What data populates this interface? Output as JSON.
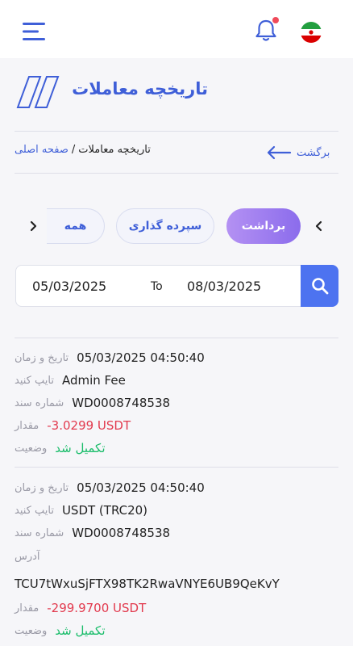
{
  "header": {
    "menu_icon": "hamburger-menu-icon",
    "bell_icon": "bell-icon",
    "notification_dot_color": "#f04a5a",
    "flag_icon": "iran-flag-icon"
  },
  "page": {
    "title": "تاریخچه معاملات"
  },
  "breadcrumb": {
    "back_label": "برگشت",
    "home": "صفحه اصلی",
    "separator": "/",
    "current": "تاریخچه معاملات"
  },
  "tabs": [
    {
      "label": "برداشت",
      "active": true
    },
    {
      "label": "سپرده گذاری",
      "active": false
    },
    {
      "label": "همه",
      "active": false
    }
  ],
  "filter": {
    "from": "05/03/2025",
    "to_label": "To",
    "to": "08/03/2025"
  },
  "labels": {
    "datetime": "تاریخ و زمان",
    "type": "تایپ کنید",
    "doc_no": "شماره سند",
    "address": "آدرس",
    "amount": "مقدار",
    "status": "وضعیت"
  },
  "records": [
    {
      "datetime": "05/03/2025 04:50:40",
      "type": "Admin Fee",
      "doc_no": "WD0008748538",
      "amount": "-3.0299 USDT",
      "status": "تکمیل شد"
    },
    {
      "datetime": "05/03/2025 04:50:40",
      "type": "USDT (TRC20)",
      "doc_no": "WD0008748538",
      "address": "TCU7tWxuSjFTX98TK2RwaVNYE6UB9QeKvY",
      "amount": "-299.9700 USDT",
      "status": "تکمیل شد"
    }
  ],
  "colors": {
    "accent": "#3f5fd8",
    "negative": "#e23a4e",
    "success": "#1bbd6b"
  }
}
